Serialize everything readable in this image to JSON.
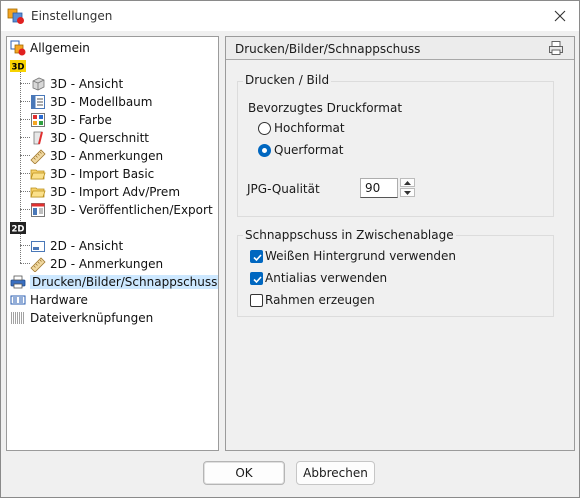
{
  "window": {
    "title": "Einstellungen"
  },
  "tree": {
    "items": [
      {
        "label": "Allgemein",
        "icon": "settings-app-icon"
      },
      {
        "label": "3D",
        "icon": "3d-badge-icon",
        "badge": true
      },
      {
        "label": "3D - Ansicht",
        "icon": "cube-icon"
      },
      {
        "label": "3D - Modellbaum",
        "icon": "model-tree-icon"
      },
      {
        "label": "3D - Farbe",
        "icon": "color-palette-icon"
      },
      {
        "label": "3D - Querschnitt",
        "icon": "cross-section-icon"
      },
      {
        "label": "3D - Anmerkungen",
        "icon": "ruler-icon"
      },
      {
        "label": "3D - Import Basic",
        "icon": "folder-open-icon"
      },
      {
        "label": "3D - Import Adv/Prem",
        "icon": "folder-open-icon"
      },
      {
        "label": "3D - Veröffentlichen/Export",
        "icon": "export-icon"
      },
      {
        "label": "2D",
        "icon": "2d-badge-icon",
        "badge": true
      },
      {
        "label": "2D - Ansicht",
        "icon": "2d-view-icon"
      },
      {
        "label": "2D - Anmerkungen",
        "icon": "ruler-icon"
      },
      {
        "label": "Drucken/Bilder/Schnappschuss",
        "icon": "printer-icon",
        "selected": true
      },
      {
        "label": "Hardware",
        "icon": "hardware-icon"
      },
      {
        "label": "Dateiverknüpfungen",
        "icon": "file-association-icon"
      }
    ]
  },
  "content": {
    "title": "Drucken/Bilder/Schnappschuss",
    "print_group": {
      "title": "Drucken / Bild",
      "format_label": "Bevorzugtes Druckformat",
      "options": [
        {
          "label": "Hochformat",
          "checked": false
        },
        {
          "label": "Querformat",
          "checked": true
        }
      ],
      "jpg_label": "JPG-Qualität",
      "jpg_value": "90"
    },
    "snapshot_group": {
      "title": "Schnappschuss in Zwischenablage",
      "options": [
        {
          "label": "Weißen Hintergrund verwenden",
          "checked": true
        },
        {
          "label": "Antialias verwenden",
          "checked": true
        },
        {
          "label": "Rahmen erzeugen",
          "checked": false
        }
      ]
    }
  },
  "buttons": {
    "ok": "OK",
    "cancel": "Abbrechen"
  },
  "colors": {
    "accent": "#0067c0",
    "selection": "#cde8ff"
  }
}
